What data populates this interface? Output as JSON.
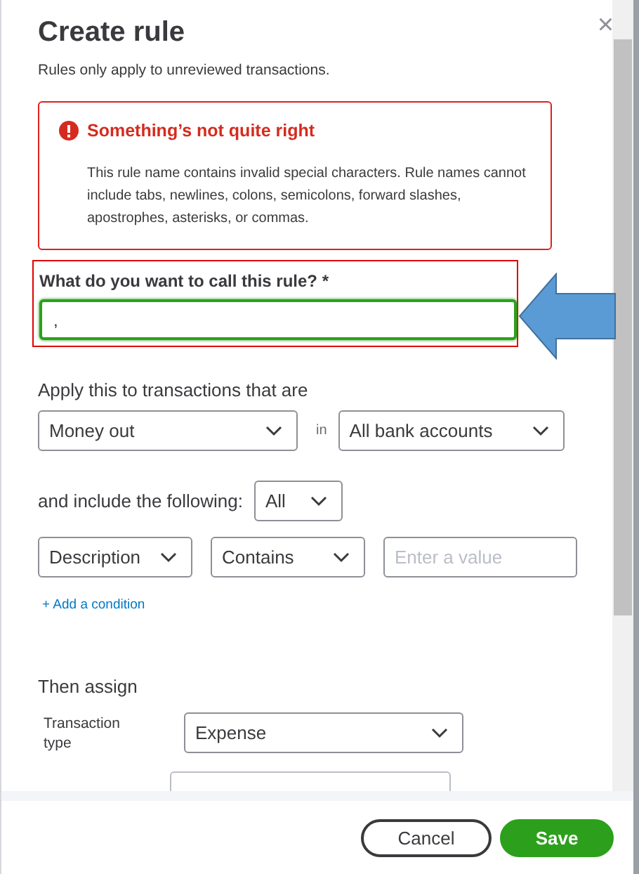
{
  "dialog": {
    "title": "Create rule",
    "subtitle": "Rules only apply to unreviewed transactions.",
    "close": "×"
  },
  "error": {
    "title": "Something’s not quite right",
    "message": "This rule name contains invalid special characters. Rule names cannot include tabs, newlines, colons, semicolons, forward slashes, apostrophes, asterisks, or commas."
  },
  "name_field": {
    "label": "What do you want to call this rule? *",
    "value": ","
  },
  "apply": {
    "label": "Apply this to transactions that are",
    "direction": "Money out",
    "connector": "in",
    "accounts": "All bank accounts"
  },
  "include": {
    "label": "and include the following:",
    "match": "All"
  },
  "conditions": [
    {
      "field": "Description",
      "operator": "Contains",
      "placeholder": "Enter a value"
    }
  ],
  "add_condition": "+ Add a condition",
  "assign": {
    "heading": "Then assign",
    "transaction_type_label": "Transaction type",
    "transaction_type": "Expense"
  },
  "buttons": [
    {
      "label": "Cancel",
      "kind": "secondary"
    },
    {
      "label": "Save",
      "kind": "primary"
    }
  ]
}
